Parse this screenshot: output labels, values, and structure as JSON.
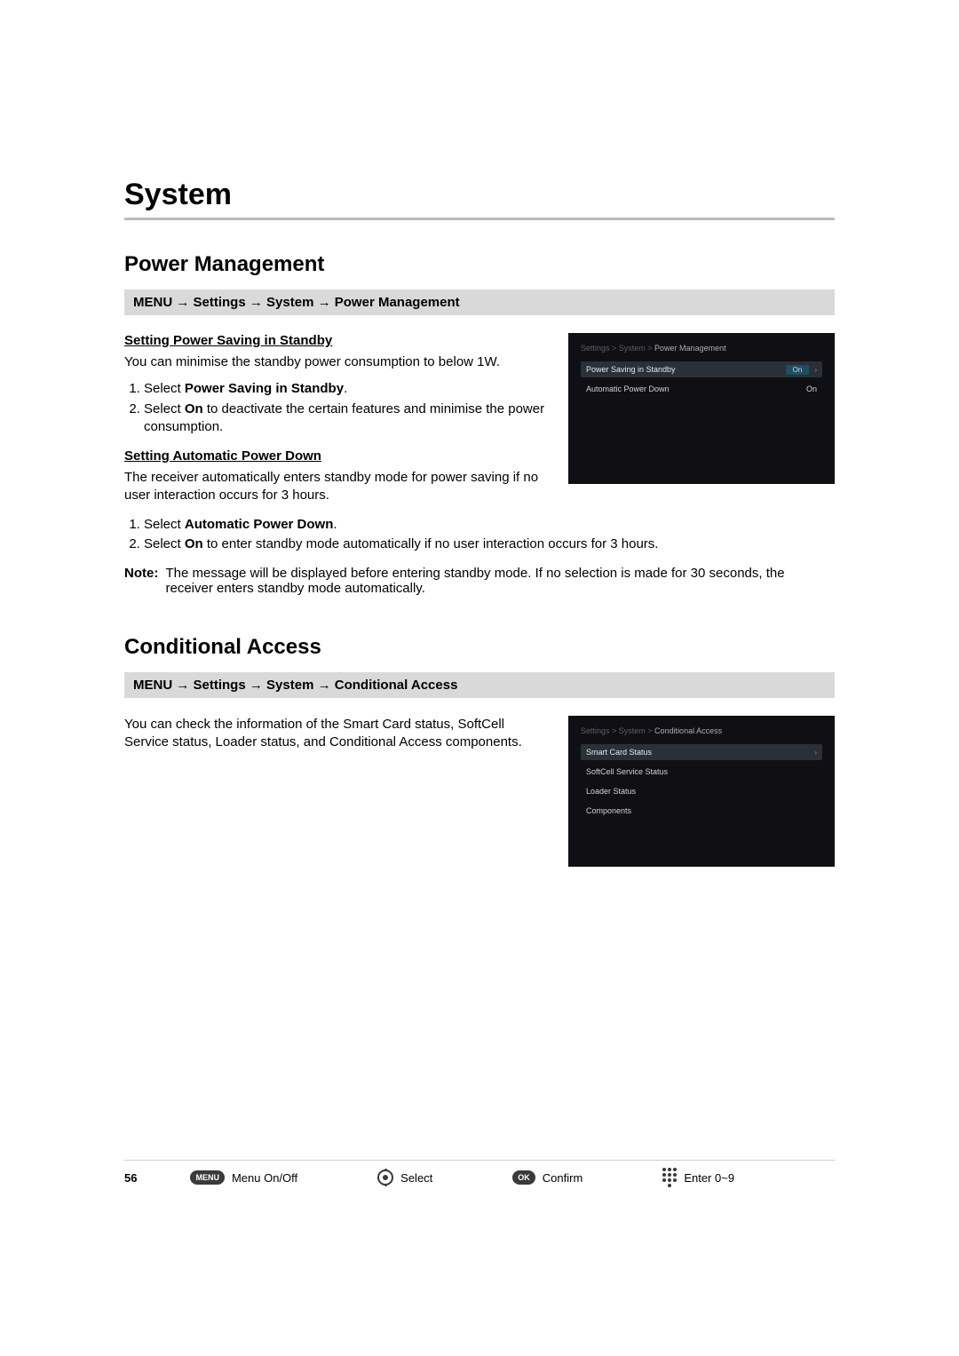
{
  "chapter_title": "System",
  "page_number": "56",
  "arrow": "→",
  "pm": {
    "title": "Power Management",
    "menu_path": [
      "MENU",
      "Settings",
      "System",
      "Power Management"
    ],
    "sub1_title": "Setting Power Saving in Standby",
    "sub1_text": "You can minimise the standby power consumption to below 1W.",
    "sub1_step1_pre": "Select ",
    "sub1_step1_bold": "Power Saving in Standby",
    "sub1_step1_post": ".",
    "sub1_step2_pre": "Select ",
    "sub1_step2_bold": "On",
    "sub1_step2_post": " to deactivate the certain features and minimise the power consumption.",
    "sub2_title": "Setting Automatic Power Down",
    "sub2_text": "The receiver automatically enters standby mode for power saving if no user interaction occurs for 3 hours.",
    "sub2_step1_pre": "Select ",
    "sub2_step1_bold": "Automatic Power Down",
    "sub2_step1_post": ".",
    "sub2_step2_pre": "Select ",
    "sub2_step2_bold": "On",
    "sub2_step2_post": " to enter standby mode automatically if no user interaction occurs for 3 hours.",
    "note_label": "Note:",
    "note_text": "The message will be displayed before entering standby mode. If no selection is made for 30 seconds, the receiver enters standby mode automatically.",
    "shot": {
      "crumb_prefix": "Settings > System > ",
      "crumb_current": "Power Management",
      "row1_label": "Power Saving in Standby",
      "row1_value": "On",
      "row2_label": "Automatic Power Down",
      "row2_value": "On"
    }
  },
  "ca": {
    "title": "Conditional Access",
    "menu_path": [
      "MENU",
      "Settings",
      "System",
      "Conditional Access"
    ],
    "text": "You can check the information of the Smart Card status, SoftCell Service status, Loader status, and Conditional Access components.",
    "shot": {
      "crumb_prefix": "Settings > System > ",
      "crumb_current": "Conditional Access",
      "row1": "Smart Card Status",
      "row2": "SoftCell Service Status",
      "row3": "Loader Status",
      "row4": "Components"
    }
  },
  "legend": {
    "menu_btn": "MENU",
    "menu_label": "Menu On/Off",
    "select_label": "Select",
    "ok_btn": "OK",
    "ok_label": "Confirm",
    "num_label": "Enter 0~9"
  }
}
